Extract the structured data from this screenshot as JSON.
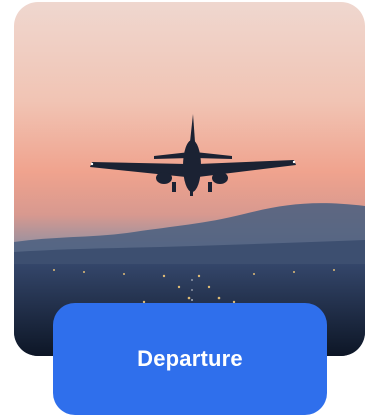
{
  "card": {
    "image": "airplane-landing-sunset-photo",
    "button_label": "Departure",
    "button_color": "#2f6fec"
  }
}
